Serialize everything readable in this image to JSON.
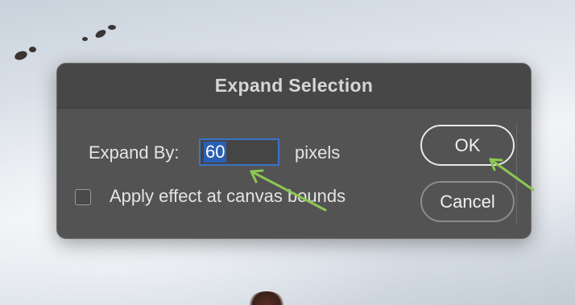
{
  "dialog": {
    "title": "Expand Selection",
    "expand_by_label": "Expand By:",
    "expand_by_value": "60",
    "unit_label": "pixels",
    "checkbox_label": "Apply effect at canvas bounds",
    "checkbox_checked": false,
    "ok_label": "OK",
    "cancel_label": "Cancel"
  },
  "annotations": {
    "arrow_color": "#8cc751",
    "arrows": [
      "arrow-to-input",
      "arrow-to-ok-button"
    ]
  },
  "colors": {
    "dialog_bg": "#535353",
    "input_highlight": "#2a5fb4",
    "input_border": "#3a74c8"
  }
}
